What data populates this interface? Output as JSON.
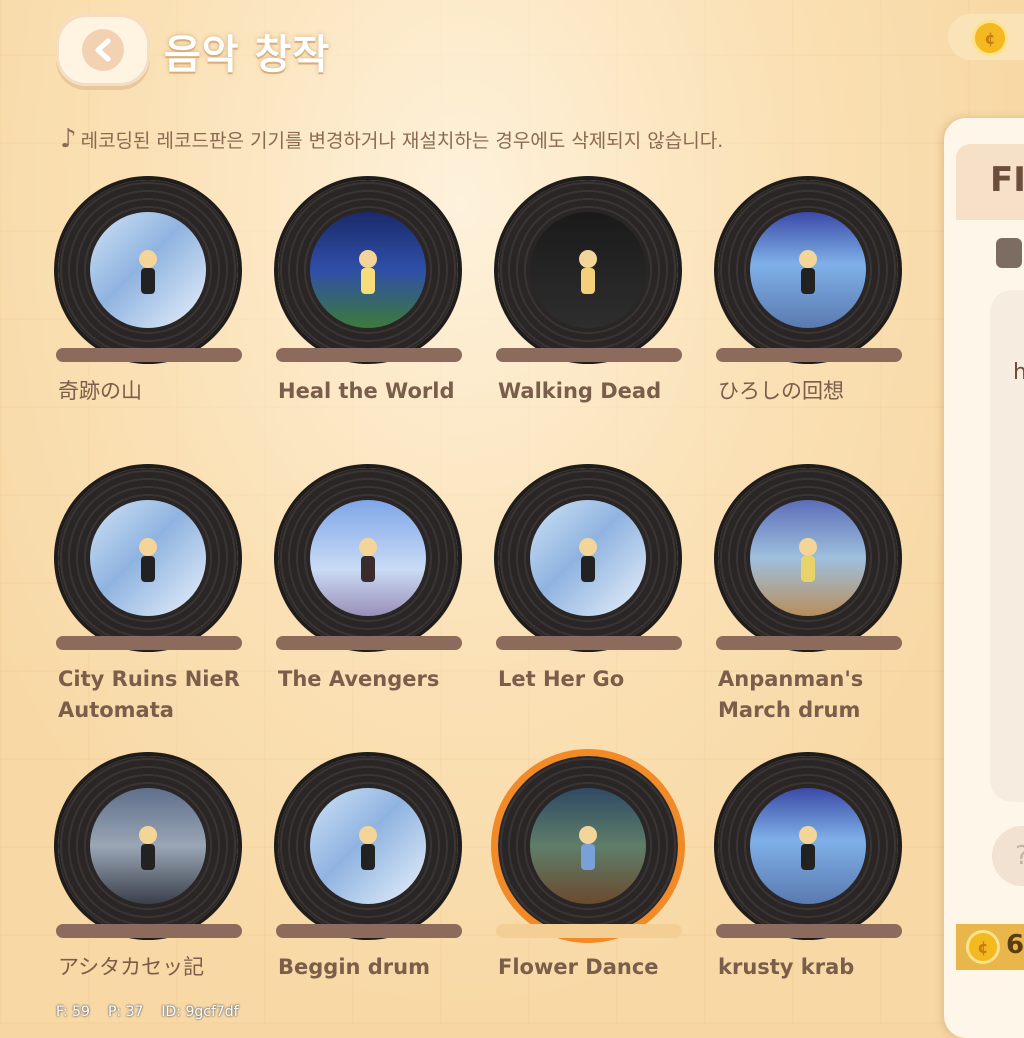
{
  "header": {
    "title": "음악 창작",
    "back_icon": "chevron-left-icon"
  },
  "notice": {
    "icon": "music-note-icon",
    "text": "레코딩된 레코드판은 기기를 변경하거나 재설치하는 경우에도 삭제되지 않습니다."
  },
  "records": [
    {
      "label": "奇跡の山",
      "selected": false,
      "art": "pale"
    },
    {
      "label": "Heal the World",
      "selected": false,
      "art": "night"
    },
    {
      "label": "Walking Dead",
      "selected": false,
      "art": "dark"
    },
    {
      "label": "ひろしの回想",
      "selected": false,
      "art": "stage"
    },
    {
      "label": "City Ruins NieR Automata",
      "selected": false,
      "art": "pale"
    },
    {
      "label": "The Avengers",
      "selected": false,
      "art": "sky"
    },
    {
      "label": "Let Her Go",
      "selected": false,
      "art": "pale"
    },
    {
      "label": "Anpanman's March drum",
      "selected": false,
      "art": "crowd"
    },
    {
      "label": "アシタカセッ記",
      "selected": false,
      "art": "house"
    },
    {
      "label": "Beggin drum",
      "selected": false,
      "art": "pale"
    },
    {
      "label": "Flower Dance",
      "selected": true,
      "art": "garden"
    },
    {
      "label": "krusty krab",
      "selected": false,
      "art": "stage"
    }
  ],
  "side_panel": {
    "title": "FI",
    "letter": "h",
    "help_label": "?",
    "coin_value": "6"
  },
  "debug": {
    "f": "F: 59",
    "p": "P: 37",
    "id": "ID: 9gcf7df"
  },
  "colors": {
    "background": "#f8d9a6",
    "selected_ring": "#f28a28",
    "label": "#7a5d4a"
  }
}
